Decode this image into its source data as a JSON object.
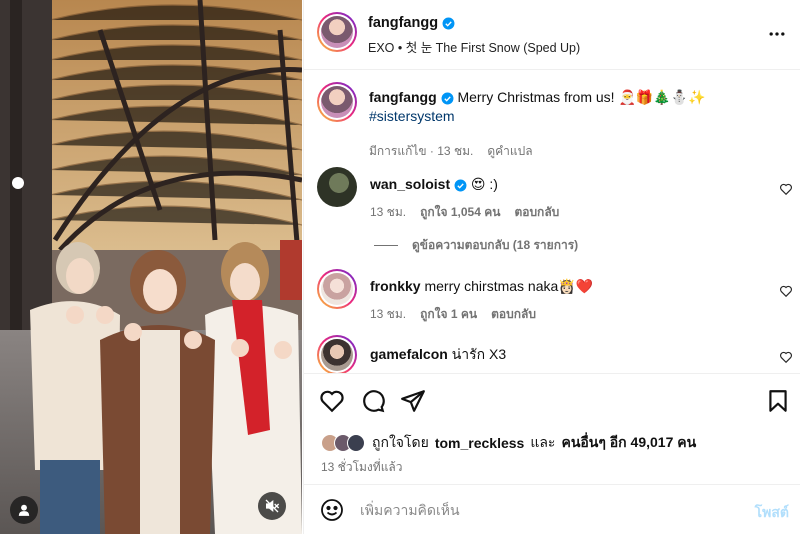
{
  "post": {
    "author": "fangfangg",
    "song": "EXO • 첫 눈 The First Snow (Sped Up)",
    "caption": "Merry Christmas from us! 🎅🎁🎄⛄✨",
    "hashtag": "#sistersystem",
    "caption_meta": {
      "edited": "มีการแก้ไข · 13 ชม.",
      "translate": "ดูคำแปล"
    }
  },
  "comments": [
    {
      "user": "wan_soloist",
      "verified": true,
      "text": "😍 :)",
      "time": "13 ชม.",
      "likes": "ถูกใจ 1,054 คน",
      "reply": "ตอบกลับ"
    },
    {
      "user": "fronkky",
      "verified": false,
      "text": "merry chirstmas naka👸🏻❤️",
      "time": "13 ชม.",
      "likes": "ถูกใจ 1 คน",
      "reply": "ตอบกลับ"
    },
    {
      "user": "gamefalcon",
      "verified": false,
      "text": "น่ารัก X3"
    }
  ],
  "view_replies": "ดูข้อความตอบกลับ (18 รายการ)",
  "liked_by": {
    "prefix": "ถูกใจโดย",
    "user": "tom_reckless",
    "and": "และ",
    "others": "คนอื่นๆ อีก 49,017 คน"
  },
  "post_time": "13 ชั่วโมงที่แล้ว",
  "composer": {
    "placeholder": "เพิ่มความคิดเห็น",
    "post_label": "โพสต์"
  },
  "icons": {
    "more": "more-horizontal-icon",
    "like": "heart-outline-icon",
    "comment": "comment-bubble-icon",
    "share": "paper-plane-icon",
    "save": "bookmark-icon",
    "emoji": "smiley-icon",
    "mute": "speaker-muted-icon",
    "tagged": "user-icon",
    "verified": "verified-badge-icon"
  },
  "colors": {
    "verified": "#0095f6",
    "post_button": "#b2dffc",
    "ring_start": "#f9ce34",
    "ring_end": "#6228d7",
    "heart": "#ed4956"
  }
}
